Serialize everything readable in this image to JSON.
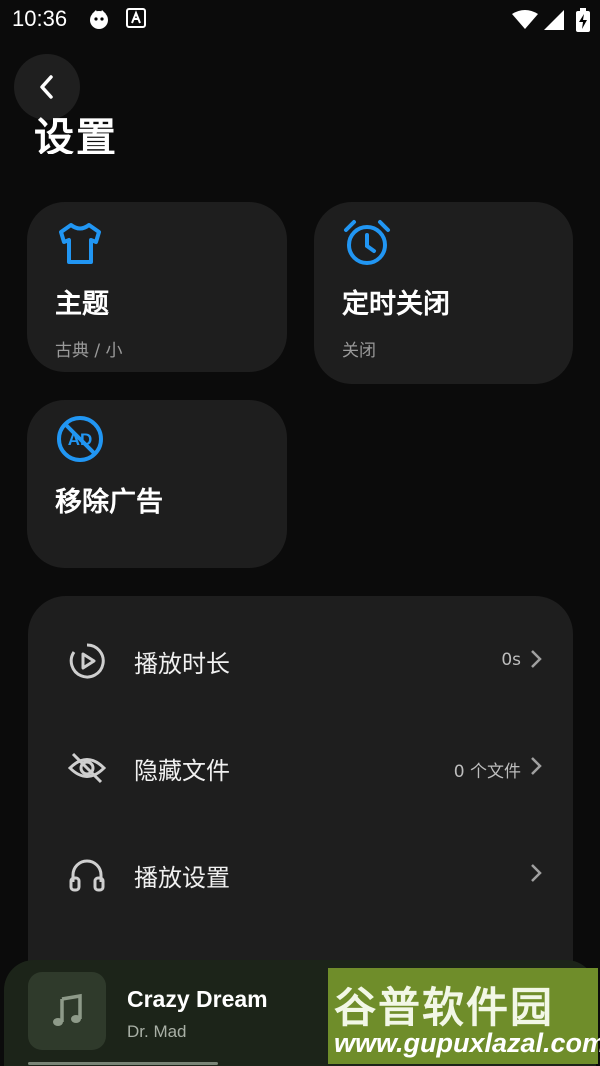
{
  "status_bar": {
    "time": "10:36"
  },
  "page": {
    "title": "设置"
  },
  "cards": [
    {
      "title": "主题",
      "subtitle": "古典 / 小",
      "icon": "shirt-icon"
    },
    {
      "title": "定时关闭",
      "subtitle": "关闭",
      "icon": "alarm-clock-icon"
    },
    {
      "title": "移除广告",
      "subtitle": "",
      "icon": "no-ads-icon"
    }
  ],
  "settings_list": [
    {
      "label": "播放时长",
      "value": "0s",
      "icon": "play-duration-icon"
    },
    {
      "label": "隐藏文件",
      "value": "0 个文件",
      "icon": "eye-off-icon"
    },
    {
      "label": "播放设置",
      "value": "",
      "icon": "headphones-icon"
    }
  ],
  "player": {
    "song": "Crazy Dream",
    "artist": "Dr. Mad",
    "progress": 0.35
  },
  "watermark": {
    "title": "谷普软件园",
    "url": "www.gupuxlazal.com"
  },
  "colors": {
    "accent": "#2196f3",
    "card_bg": "#1e1e1e",
    "background": "#0b0b0b"
  }
}
